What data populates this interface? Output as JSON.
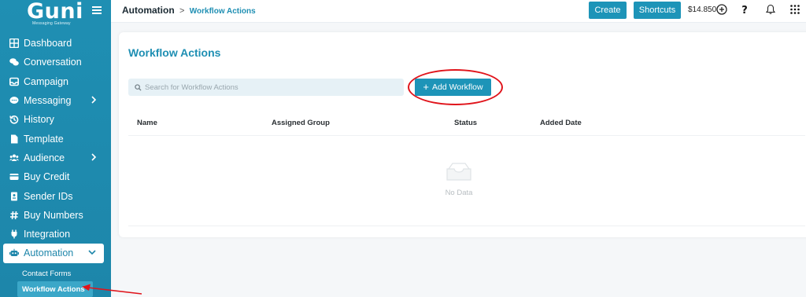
{
  "brand": {
    "logo_text": "Guni",
    "tagline": "Messaging Gateway"
  },
  "sidebar": {
    "items": [
      {
        "label": "Dashboard",
        "icon": "dashboard-icon"
      },
      {
        "label": "Conversation",
        "icon": "chat-icon"
      },
      {
        "label": "Campaign",
        "icon": "inbox-icon"
      },
      {
        "label": "Messaging",
        "icon": "message-icon",
        "chevron": "right"
      },
      {
        "label": "History",
        "icon": "history-icon"
      },
      {
        "label": "Template",
        "icon": "document-icon"
      },
      {
        "label": "Audience",
        "icon": "users-icon",
        "chevron": "right"
      },
      {
        "label": "Buy Credit",
        "icon": "credit-card-icon"
      },
      {
        "label": "Sender IDs",
        "icon": "id-badge-icon"
      },
      {
        "label": "Buy Numbers",
        "icon": "hash-icon"
      },
      {
        "label": "Integration",
        "icon": "plug-icon"
      },
      {
        "label": "Automation",
        "icon": "robot-icon",
        "chevron": "down",
        "active": true
      }
    ],
    "subitems": [
      {
        "label": "Contact Forms"
      },
      {
        "label": "Workflow Actions",
        "current": true
      }
    ]
  },
  "topbar": {
    "breadcrumb_root": "Automation",
    "breadcrumb_sep": ">",
    "breadcrumb_leaf": "Workflow Actions",
    "create_label": "Create",
    "shortcuts_label": "Shortcuts",
    "balance": "$14.850"
  },
  "page": {
    "title": "Workflow Actions",
    "search_placeholder": "Search for Workflow Actions",
    "add_button_label": "Add Workflow",
    "columns": [
      "Name",
      "Assigned Group",
      "Status",
      "Added Date"
    ],
    "empty_text": "No Data"
  },
  "colors": {
    "accent": "#1d94b8",
    "sidebar": "#1f8fb3",
    "annotation": "#e0141b"
  }
}
